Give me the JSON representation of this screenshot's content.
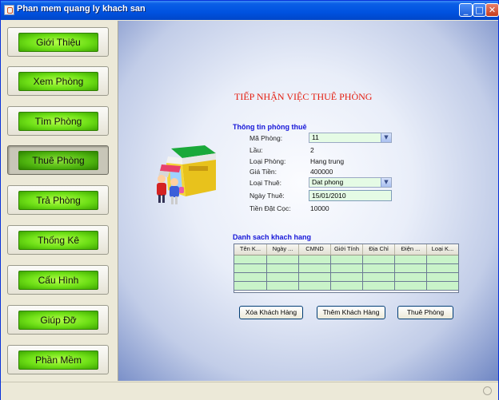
{
  "window": {
    "title": "Phan mem quang ly khach san"
  },
  "titlebar_buttons": {
    "minimize": "_",
    "maximize": "□",
    "close": "✕"
  },
  "nav": [
    {
      "label": "Giới Thiệu"
    },
    {
      "label": "Xem Phòng"
    },
    {
      "label": "Tìm Phòng"
    },
    {
      "label": "Thuê Phòng",
      "selected": true
    },
    {
      "label": "Trả Phòng"
    },
    {
      "label": "Thống Kê"
    },
    {
      "label": "Cấu Hình"
    },
    {
      "label": "Giúp Đỡ"
    },
    {
      "label": "Phần Mềm"
    }
  ],
  "main": {
    "title": "TIẾP NHẬN VIỆC THUÊ PHÒNG",
    "room_section": "Thông tin phòng thuê",
    "fields": {
      "ma_phong": {
        "label": "Mã Phòng:",
        "value": "11"
      },
      "lau": {
        "label": "Lầu:",
        "value": "2"
      },
      "loai_phong": {
        "label": "Loại Phòng:",
        "value": "Hang trung"
      },
      "gia_tien": {
        "label": "Giá Tiền:",
        "value": "400000"
      },
      "loai_thue": {
        "label": "Loại Thuê:",
        "value": "Dat phong"
      },
      "ngay_thue": {
        "label": "Ngày Thuê:",
        "value": "15/01/2010"
      },
      "tien_dat_coc": {
        "label": "Tiền Đặt Cọc:",
        "value": "10000"
      }
    },
    "customers_section": "Danh sach khach hang",
    "table": {
      "columns": [
        "Tên K...",
        "Ngày ...",
        "CMND",
        "Giới Tính",
        "Địa Chỉ",
        "Điện ...",
        "Loại K..."
      ],
      "rows": [
        [
          "",
          "",
          "",
          "",
          "",
          "",
          ""
        ],
        [
          "",
          "",
          "",
          "",
          "",
          "",
          ""
        ],
        [
          "",
          "",
          "",
          "",
          "",
          "",
          ""
        ],
        [
          "",
          "",
          "",
          "",
          "",
          "",
          ""
        ]
      ]
    },
    "buttons": {
      "delete": "Xóa Khách Hàng",
      "add": "Thêm Khách Hàng",
      "rent": "Thuê Phòng"
    }
  },
  "colors": {
    "title_red": "#e41c0e",
    "section_blue": "#1515d8",
    "nav_green": "#6fe017",
    "field_bg": "#e5fbe5"
  }
}
